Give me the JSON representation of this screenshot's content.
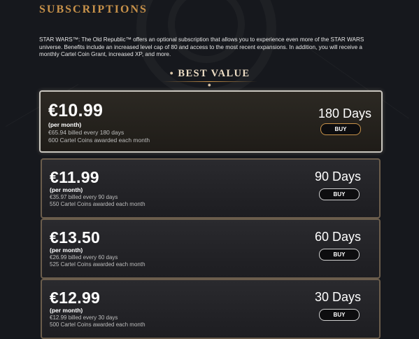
{
  "page": {
    "title": "SUBSCRIPTIONS",
    "intro": "STAR WARS™: The Old Republic™ offers an optional subscription that allows you to experience even more of the STAR WARS universe. Benefits include an increased level cap of 80 and access to the most recent expansions. In addition, you will receive a monthly Cartel Coin Grant, increased XP, and more.",
    "best_value": "BEST VALUE"
  },
  "plans": [
    {
      "price": "€10.99",
      "per": "(per month)",
      "billed": "€65.94 billed every 180 days",
      "coins": "600 Cartel Coins awarded each month",
      "days": "180 Days",
      "buy": "BUY"
    },
    {
      "price": "€11.99",
      "per": "(per month)",
      "billed": "€35.97 billed every 90 days",
      "coins": "550 Cartel Coins awarded each month",
      "days": "90 Days",
      "buy": "BUY"
    },
    {
      "price": "€13.50",
      "per": "(per month)",
      "billed": "€26.99 billed every 60 days",
      "coins": "525 Cartel Coins awarded each month",
      "days": "60 Days",
      "buy": "BUY"
    },
    {
      "price": "€12.99",
      "per": "(per month)",
      "billed": "€12.99 billed every 30 days",
      "coins": "500 Cartel Coins awarded each month",
      "days": "30 Days",
      "buy": "BUY"
    }
  ],
  "colors": {
    "accent": "#c8924a",
    "background": "#16181d"
  }
}
